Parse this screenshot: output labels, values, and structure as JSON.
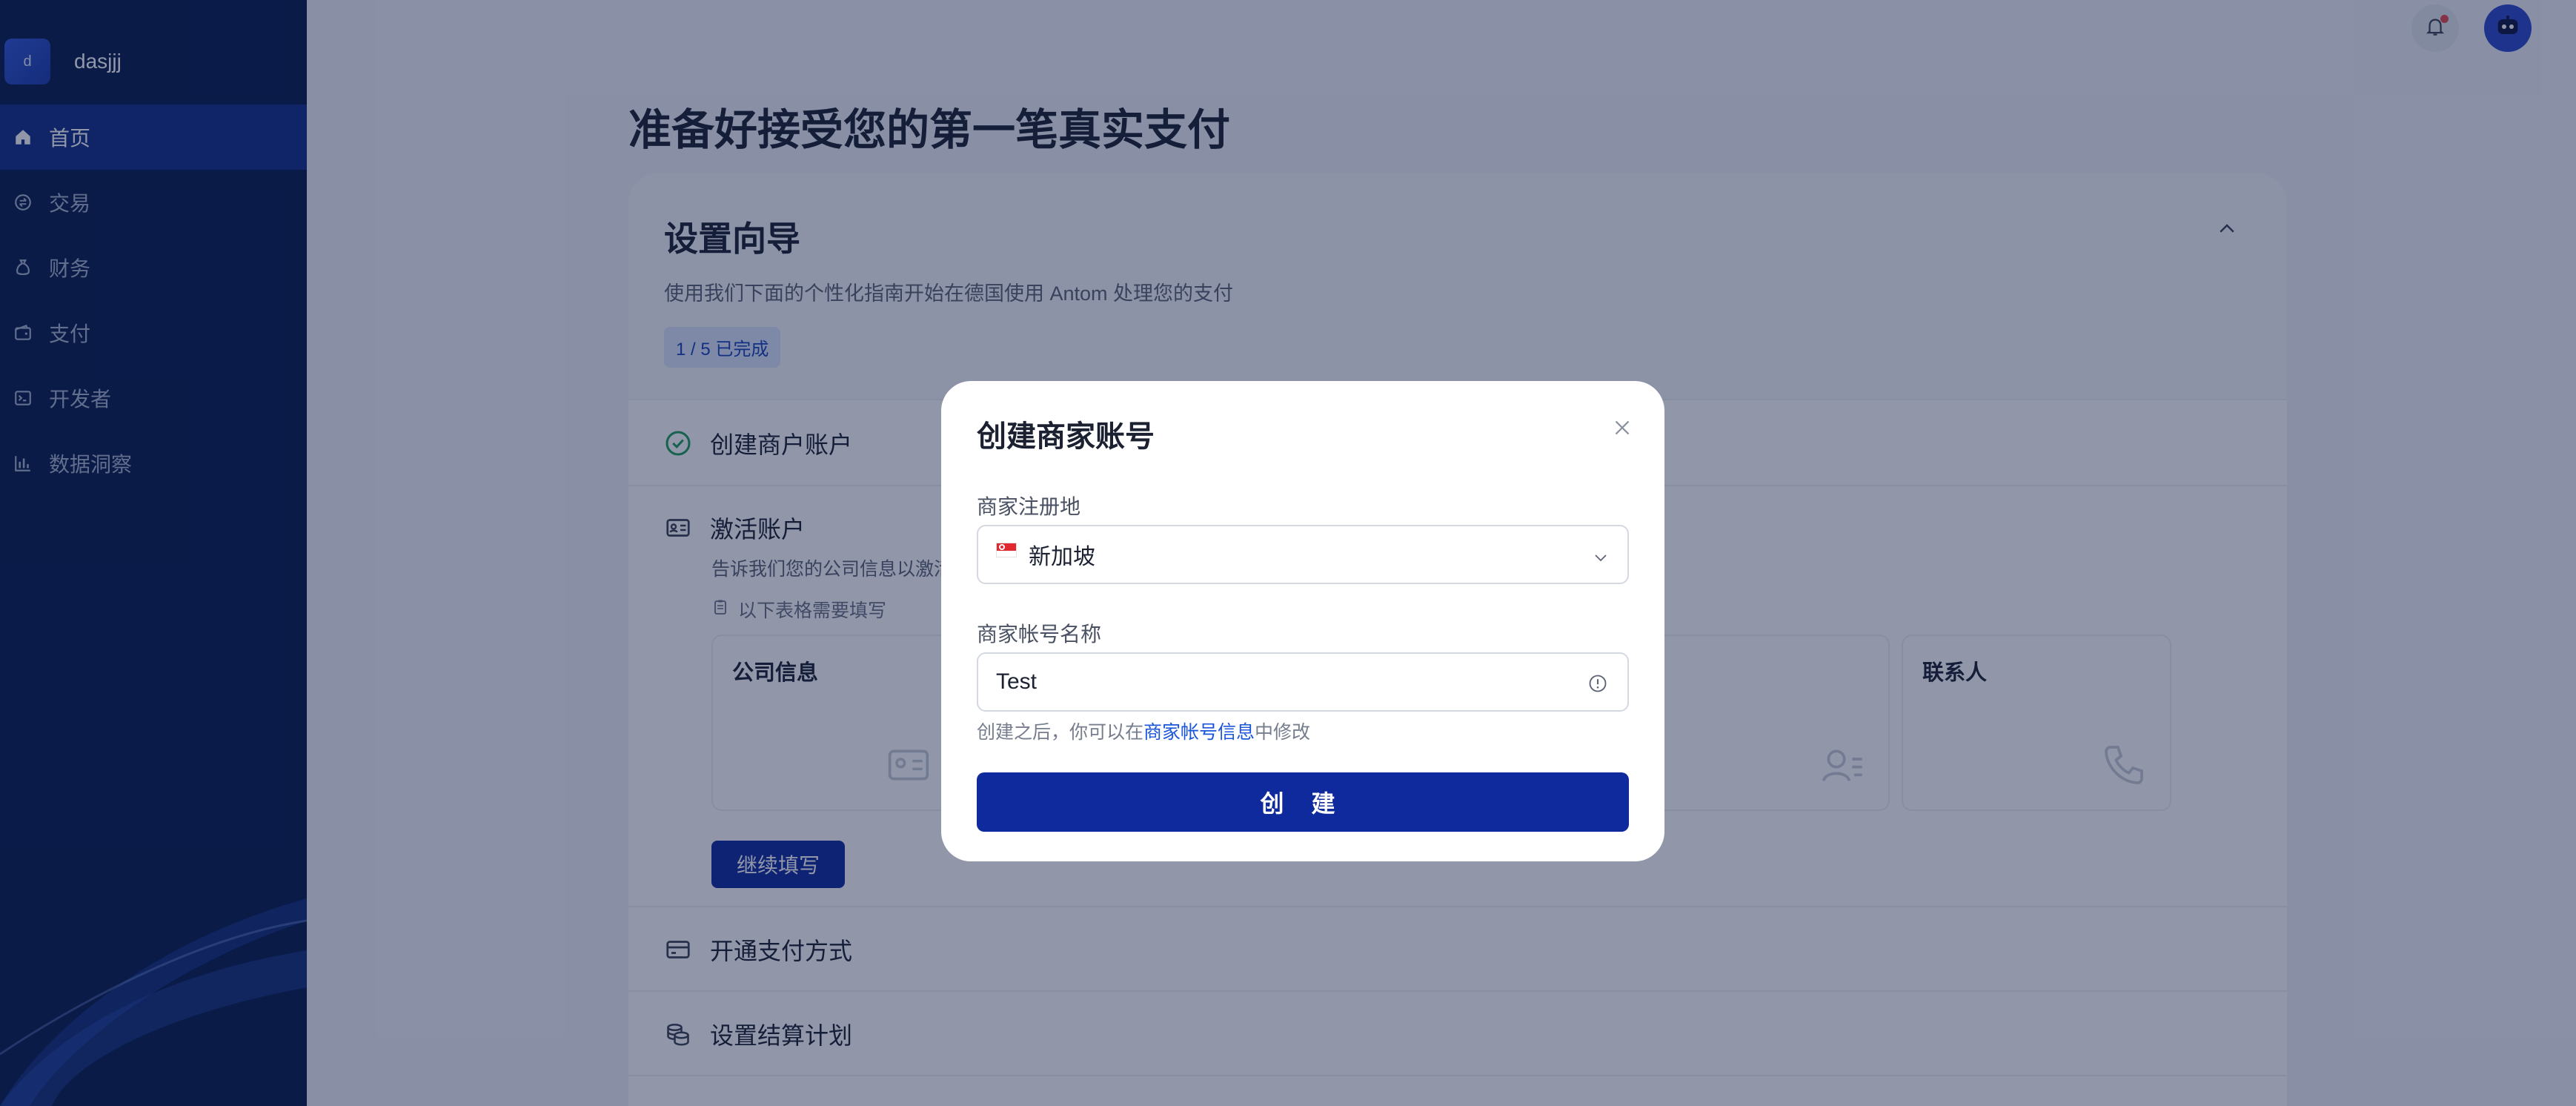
{
  "sidebar": {
    "brand_initial": "d",
    "brand_name": "dasjjj",
    "items": [
      {
        "label": "首页",
        "icon": "home-icon",
        "active": true
      },
      {
        "label": "交易",
        "icon": "exchange-icon",
        "active": false
      },
      {
        "label": "财务",
        "icon": "moneybag-icon",
        "active": false
      },
      {
        "label": "支付",
        "icon": "wallet-icon",
        "active": false
      },
      {
        "label": "开发者",
        "icon": "terminal-icon",
        "active": false
      },
      {
        "label": "数据洞察",
        "icon": "bar-chart-icon",
        "active": false
      }
    ]
  },
  "header": {
    "notification_icon": "bell-icon",
    "avatar_icon": "robot-avatar-icon"
  },
  "main": {
    "page_title": "准备好接受您的第一笔真实支付",
    "setup": {
      "title": "设置向导",
      "subtitle": "使用我们下面的个性化指南开始在德国使用 Antom 处理您的支付",
      "progress": "1 / 5 已完成",
      "steps": [
        {
          "label": "创建商户账户",
          "icon": "check-circle-icon",
          "done": true
        },
        {
          "label": "激活账户",
          "icon": "id-card-icon",
          "description": "告诉我们您的公司信息以激活",
          "need_fill": "以下表格需要填写",
          "forms": [
            {
              "label": "公司信息",
              "icon": "id-card-icon"
            },
            {
              "label": "",
              "icon": "person-card-icon"
            },
            {
              "label": "联系人",
              "icon": "phone-icon"
            }
          ],
          "continue_label": "继续填写"
        },
        {
          "label": "开通支付方式",
          "icon": "credit-card-icon"
        },
        {
          "label": "设置结算计划",
          "icon": "coins-icon"
        }
      ]
    }
  },
  "modal": {
    "title": "创建商家账号",
    "close_icon": "close-icon",
    "region_label": "商家注册地",
    "region_value": "新加坡",
    "region_flag": "singapore-flag-icon",
    "name_label": "商家帐号名称",
    "name_value": "Test",
    "hint_prefix": "创建之后，你可以在",
    "hint_link": "商家帐号信息",
    "hint_suffix": "中修改",
    "create_label": "创 建"
  },
  "colors": {
    "sidebar_bg": "#071a4d",
    "sidebar_active": "#0f2e87",
    "primary_button": "#0e2a9c",
    "link": "#1a56db",
    "badge_bg": "#dde6fb",
    "badge_text": "#1741b8",
    "success": "#1f9e5a"
  }
}
